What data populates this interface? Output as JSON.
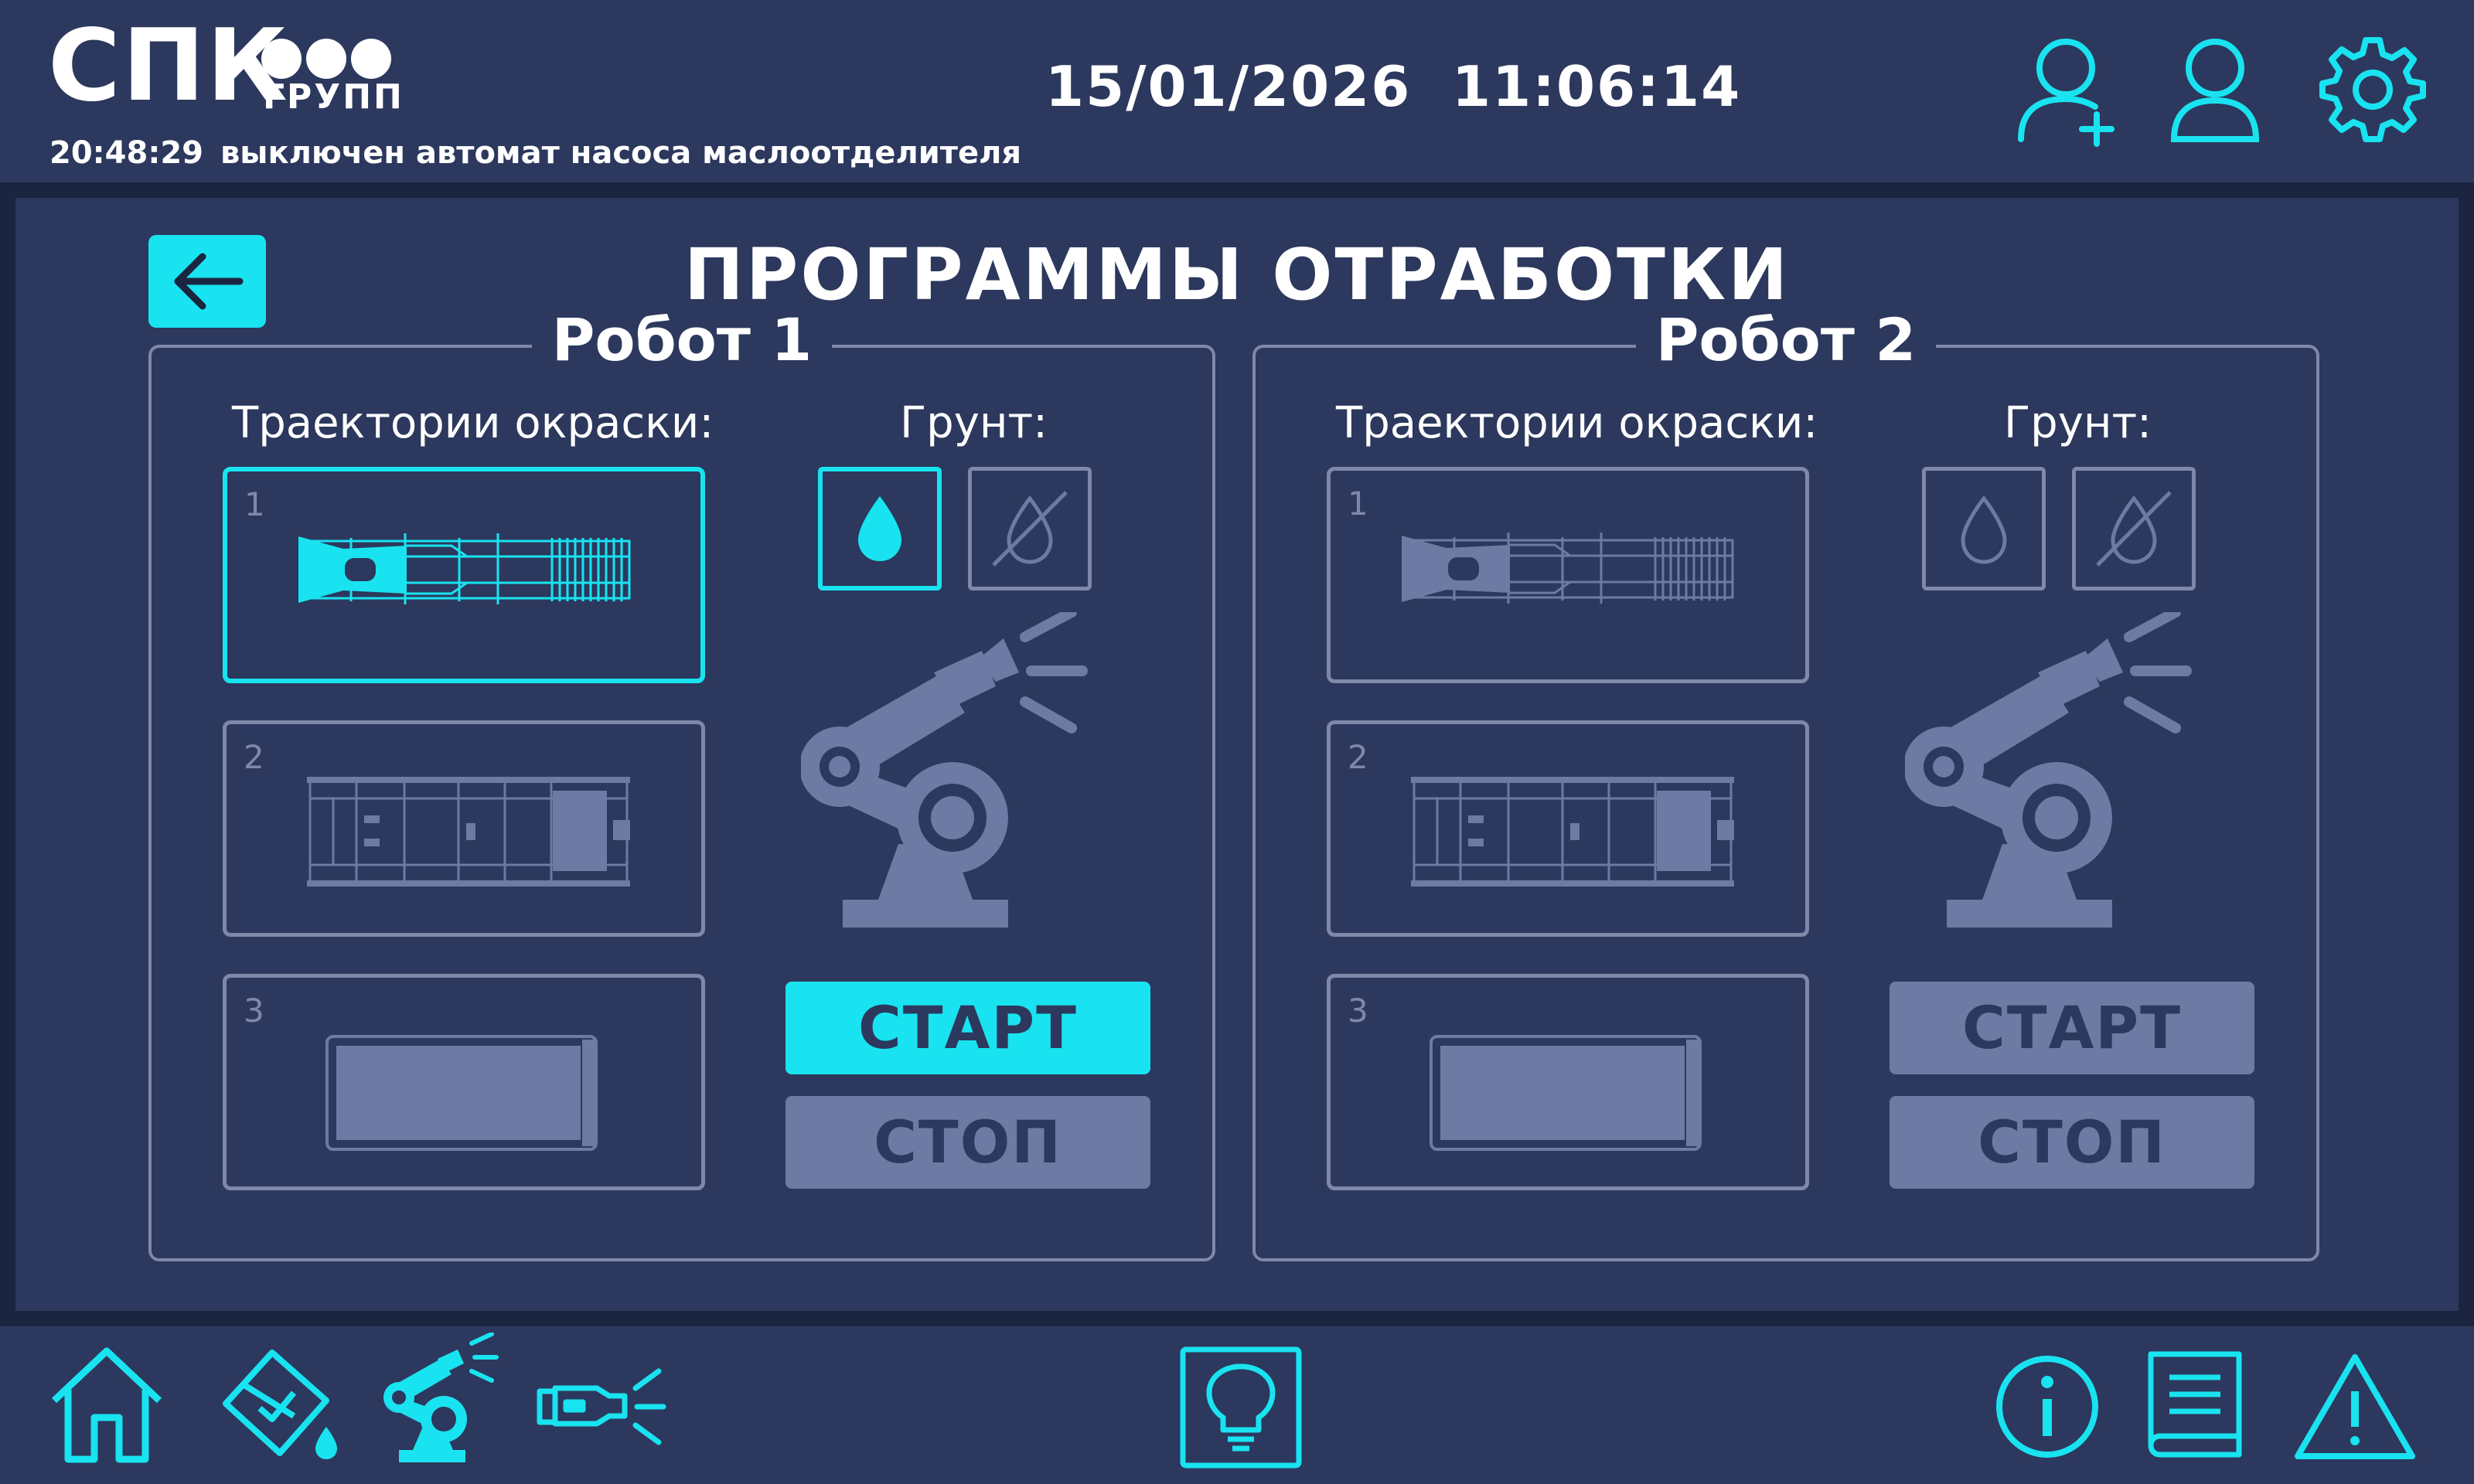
{
  "header": {
    "logo_main": "СПК",
    "logo_sub": "ГРУПП",
    "status_time": "20:48:29",
    "status_message": "выключен автомат насоса маслоотделителя",
    "date": "15/01/2026",
    "time": "11:06:14",
    "icons": [
      "add-user-icon",
      "user-icon",
      "settings-gear-icon"
    ]
  },
  "page": {
    "title": "ПРОГРАММЫ ОТРАБОТКИ",
    "back_icon": "arrow-left-icon"
  },
  "robots": [
    {
      "title": "Робот 1",
      "trajectories_label": "Траектории окраски:",
      "primer_label": "Грунт:",
      "trajectories": [
        {
          "number": "1",
          "selected": true
        },
        {
          "number": "2",
          "selected": false
        },
        {
          "number": "3",
          "selected": false
        }
      ],
      "primer_on_selected": true,
      "primer_off_selected": false,
      "start_label": "СТАРТ",
      "stop_label": "СТОП",
      "start_active": true
    },
    {
      "title": "Робот 2",
      "trajectories_label": "Траектории окраски:",
      "primer_label": "Грунт:",
      "trajectories": [
        {
          "number": "1",
          "selected": false
        },
        {
          "number": "2",
          "selected": false
        },
        {
          "number": "3",
          "selected": false
        }
      ],
      "primer_on_selected": false,
      "primer_off_selected": false,
      "start_label": "СТАРТ",
      "stop_label": "СТОП",
      "start_active": false
    }
  ],
  "footer": {
    "left_icons": [
      "home-icon",
      "paint-bucket-icon",
      "paint-robot-icon",
      "spray-gun-icon"
    ],
    "center_icon": "lightbulb-icon",
    "right_icons": [
      "info-icon",
      "manual-book-icon",
      "warning-icon"
    ]
  },
  "colors": {
    "accent": "#19e3f0",
    "panel_bg": "#2c385d",
    "page_bg": "#1b2540",
    "inactive": "#6c7aa4",
    "border": "#7e89aa"
  }
}
